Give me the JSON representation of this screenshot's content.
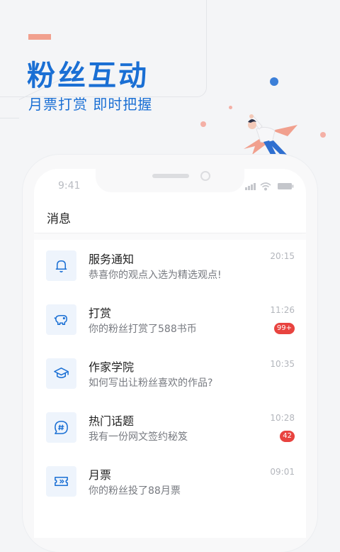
{
  "promo": {
    "headline": "粉丝互动",
    "subline": "月票打赏 即时把握"
  },
  "status_bar": {
    "time": "9:41"
  },
  "messages_screen": {
    "title": "消息",
    "items": [
      {
        "icon": "bell-icon",
        "title": "服务通知",
        "subtitle": "恭喜你的观点入选为精选观点!",
        "time": "20:15",
        "badge": ""
      },
      {
        "icon": "piggy-bank-icon",
        "title": "打赏",
        "subtitle": "你的粉丝打赏了588书币",
        "time": "11:26",
        "badge": "99+"
      },
      {
        "icon": "graduation-cap-icon",
        "title": "作家学院",
        "subtitle": "如何写出让粉丝喜欢的作品?",
        "time": "10:35",
        "badge": ""
      },
      {
        "icon": "hashtag-chat-icon",
        "title": "热门话题",
        "subtitle": "我有一份网文签约秘笈",
        "time": "10:28",
        "badge": "42"
      },
      {
        "icon": "ticket-icon",
        "title": "月票",
        "subtitle": "你的粉丝投了88月票",
        "time": "09:01",
        "badge": ""
      }
    ]
  },
  "colors": {
    "brand_blue": "#1a6fd4",
    "accent_pink": "#f1a08e",
    "badge_red": "#e8433f"
  }
}
